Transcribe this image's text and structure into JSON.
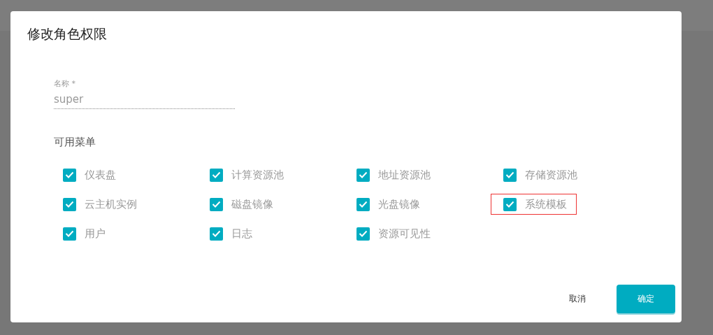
{
  "dialog": {
    "title": "修改角色权限"
  },
  "name_field": {
    "label": "名称 *",
    "value": "super"
  },
  "menu_section": {
    "title": "可用菜单"
  },
  "menus": [
    {
      "label": "仪表盘",
      "checked": true,
      "highlighted": false
    },
    {
      "label": "计算资源池",
      "checked": true,
      "highlighted": false
    },
    {
      "label": "地址资源池",
      "checked": true,
      "highlighted": false
    },
    {
      "label": "存储资源池",
      "checked": true,
      "highlighted": false
    },
    {
      "label": "云主机实例",
      "checked": true,
      "highlighted": false
    },
    {
      "label": "磁盘镜像",
      "checked": true,
      "highlighted": false
    },
    {
      "label": "光盘镜像",
      "checked": true,
      "highlighted": false
    },
    {
      "label": "系统模板",
      "checked": true,
      "highlighted": true
    },
    {
      "label": "用户",
      "checked": true,
      "highlighted": false
    },
    {
      "label": "日志",
      "checked": true,
      "highlighted": false
    },
    {
      "label": "资源可见性",
      "checked": true,
      "highlighted": false
    }
  ],
  "buttons": [
    {
      "label": "取消",
      "kind": "text"
    },
    {
      "label": "确定",
      "kind": "primary"
    }
  ]
}
